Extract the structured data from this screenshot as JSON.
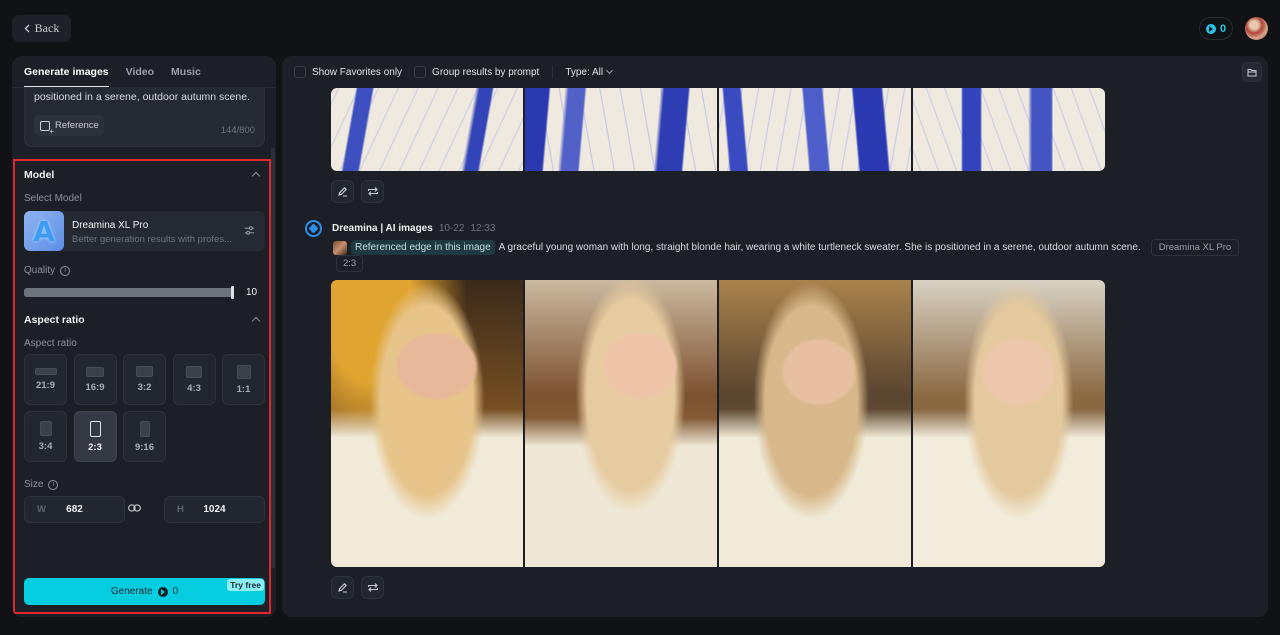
{
  "header": {
    "back_label": "Back",
    "credits": "0"
  },
  "left_panel": {
    "tabs": [
      {
        "label": "Generate images",
        "active": true
      },
      {
        "label": "Video",
        "active": false
      },
      {
        "label": "Music",
        "active": false
      }
    ],
    "prompt": {
      "visible_text": "positioned in a serene, outdoor autumn scene.",
      "reference_label": "Reference",
      "char_count": "144/800"
    },
    "model_section": {
      "title": "Model",
      "select_label": "Select Model",
      "model_name": "Dreamina XL Pro",
      "model_desc": "Better generation results with profes...",
      "quality_label": "Quality",
      "quality_value": "10",
      "quality_fraction": 1.0
    },
    "aspect_section": {
      "title": "Aspect ratio",
      "sub_label": "Aspect ratio",
      "options": [
        {
          "label": "21:9",
          "selected": false
        },
        {
          "label": "16:9",
          "selected": false
        },
        {
          "label": "3:2",
          "selected": false
        },
        {
          "label": "4:3",
          "selected": false
        },
        {
          "label": "1:1",
          "selected": false
        },
        {
          "label": "3:4",
          "selected": false
        },
        {
          "label": "2:3",
          "selected": true
        },
        {
          "label": "9:16",
          "selected": false
        }
      ]
    },
    "size_section": {
      "label": "Size",
      "width_prefix": "W",
      "width": "682",
      "height_prefix": "H",
      "height": "1024"
    },
    "generate": {
      "label": "Generate",
      "cost": "0",
      "badge": "Try free"
    }
  },
  "main": {
    "toolbar": {
      "favorites_label": "Show Favorites only",
      "group_label": "Group results by prompt",
      "type_label": "Type: All"
    },
    "entry": {
      "bot_name": "Dreamina | AI images",
      "date": "10-22",
      "time": "12:33",
      "reference_chip": "Referenced edge in this image",
      "prompt": "A graceful young woman with long, straight blonde hair, wearing a white turtleneck sweater. She is positioned in a serene, outdoor autumn scene.",
      "model_tag": "Dreamina XL Pro",
      "ratio_tag": "2:3"
    }
  }
}
